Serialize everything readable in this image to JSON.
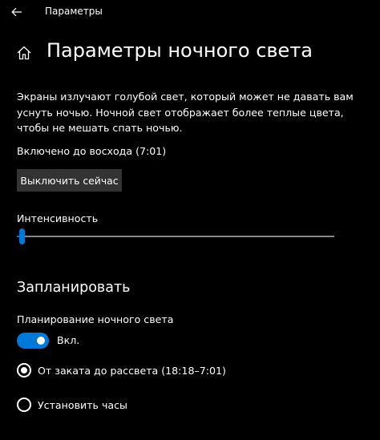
{
  "window": {
    "title": "Параметры"
  },
  "header": {
    "title": "Параметры ночного света"
  },
  "content": {
    "description": "Экраны излучают голубой свет, который может не давать вам уснуть ночью. Ночной свет отображает более теплые цвета, чтобы не мешать спать ночью.",
    "status": "Включено до восхода (7:01)",
    "turn_off_button": "Выключить сейчас",
    "intensity_label": "Интенсивность",
    "intensity_percent": 1
  },
  "schedule": {
    "heading": "Запланировать",
    "toggle_label": "Планирование ночного света",
    "toggle_on": true,
    "toggle_state_text": "Вкл.",
    "options": [
      {
        "label": "От заката до рассвета (18:18–7:01)",
        "selected": true
      },
      {
        "label": "Установить часы",
        "selected": false
      }
    ]
  },
  "colors": {
    "background": "#000000",
    "accent": "#0078d7",
    "button": "#333333",
    "text": "#ffffff"
  },
  "icons": {
    "back": "arrow-left-icon",
    "home": "home-icon"
  }
}
